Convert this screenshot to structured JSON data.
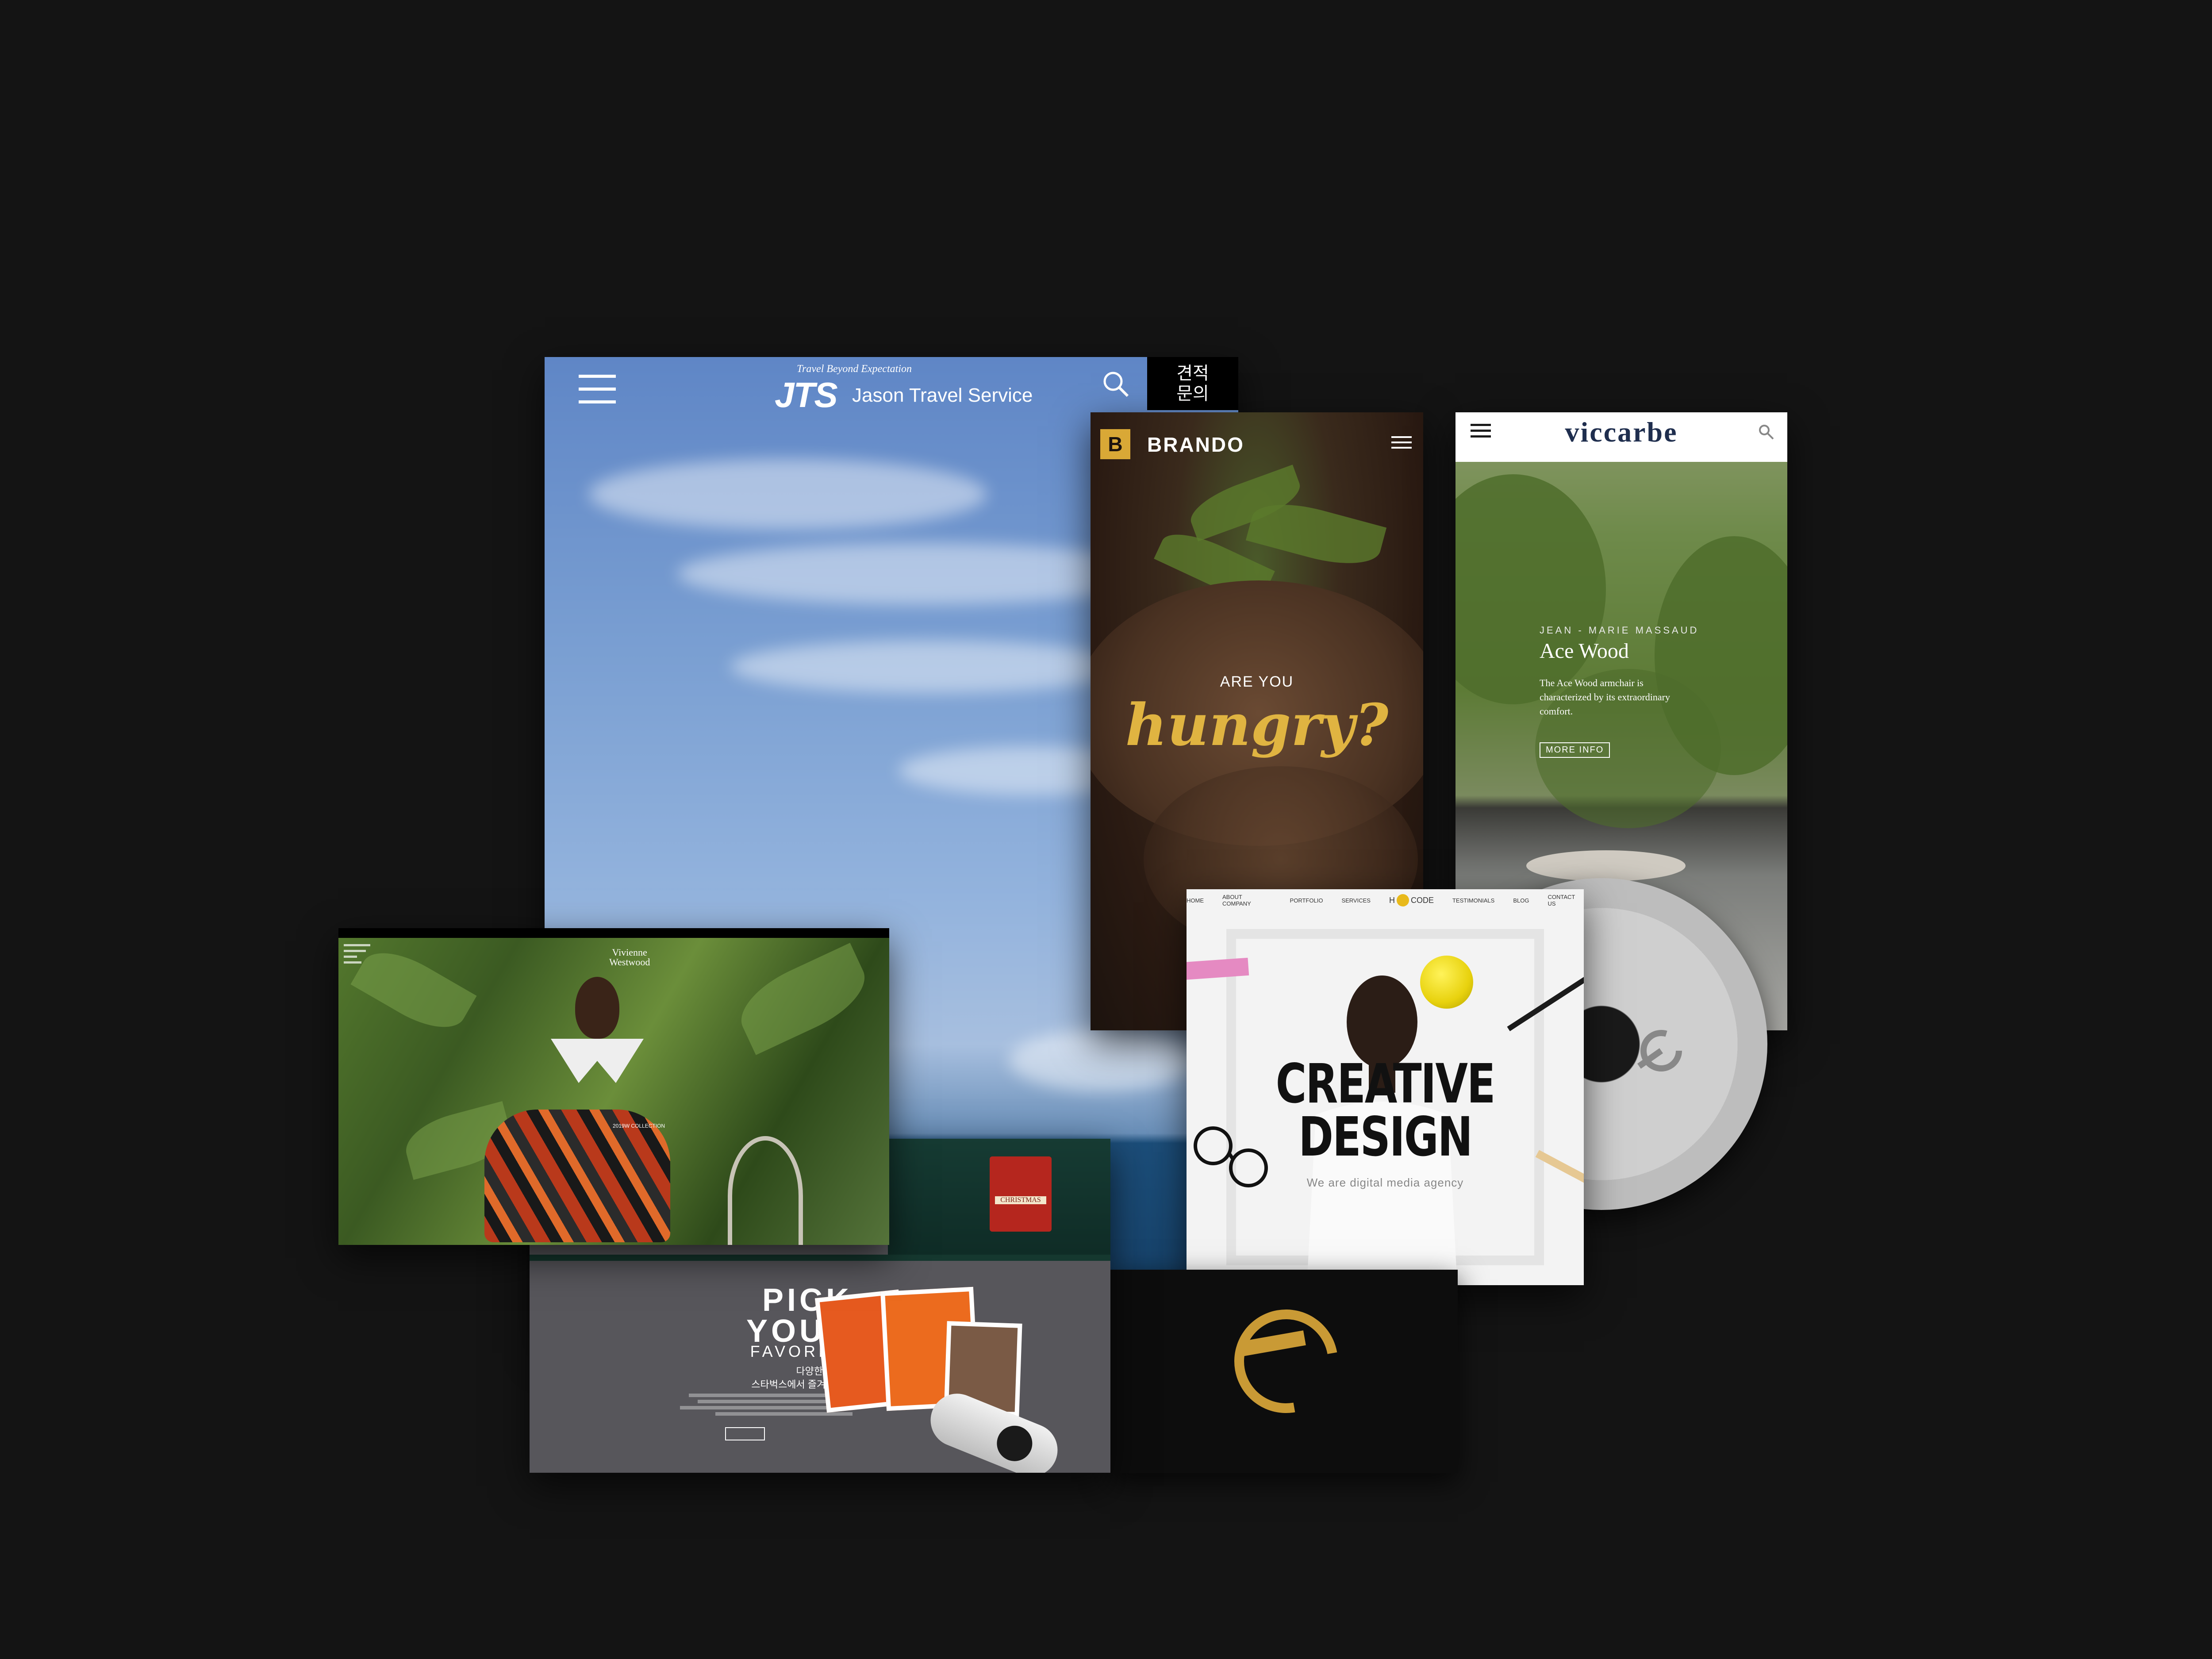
{
  "jts": {
    "tagline": "Travel Beyond Expectation",
    "logo_mark": "JTS",
    "logo_name": "Jason Travel Service",
    "quote_button": "견적\n문의",
    "icons": [
      "menu-icon",
      "search-icon"
    ]
  },
  "brando": {
    "logo_letter": "B",
    "name": "BRANDO",
    "headline_small": "ARE YOU",
    "headline_big": "hungry?",
    "icons": [
      "menu-icon"
    ]
  },
  "viccarbe": {
    "logo": "viccarbe",
    "author": "JEAN - MARIE MASSAUD",
    "title": "Ace Wood",
    "description": "The Ace Wood armchair is characterized by its extraordinary comfort.",
    "button": "MORE INFO",
    "icons": [
      "menu-icon",
      "search-icon"
    ]
  },
  "hcode": {
    "nav": [
      "HOME",
      "ABOUT COMPANY",
      "PORTFOLIO",
      "SERVICES",
      "TESTIMONIALS",
      "BLOG",
      "CONTACT US"
    ],
    "logo_left": "H",
    "logo_right": "CODE",
    "title": "CREATIVE\nDESIGN",
    "tagline": "We are digital media agency"
  },
  "westwood": {
    "logo": "Vivienne\nWestwood",
    "collection": "2019W COLLECTION"
  },
  "starbucks": {
    "headline": "PICK\nYOUR",
    "subhead": "FAVORITE",
    "korean_line1": "다양한 메뉴를",
    "korean_line2": "스타벅스에서 즐겨보세요",
    "christmas_label": "CHRISTMAS",
    "colors": {
      "green": "#0f2c26",
      "orange": "#e65a1f"
    }
  }
}
